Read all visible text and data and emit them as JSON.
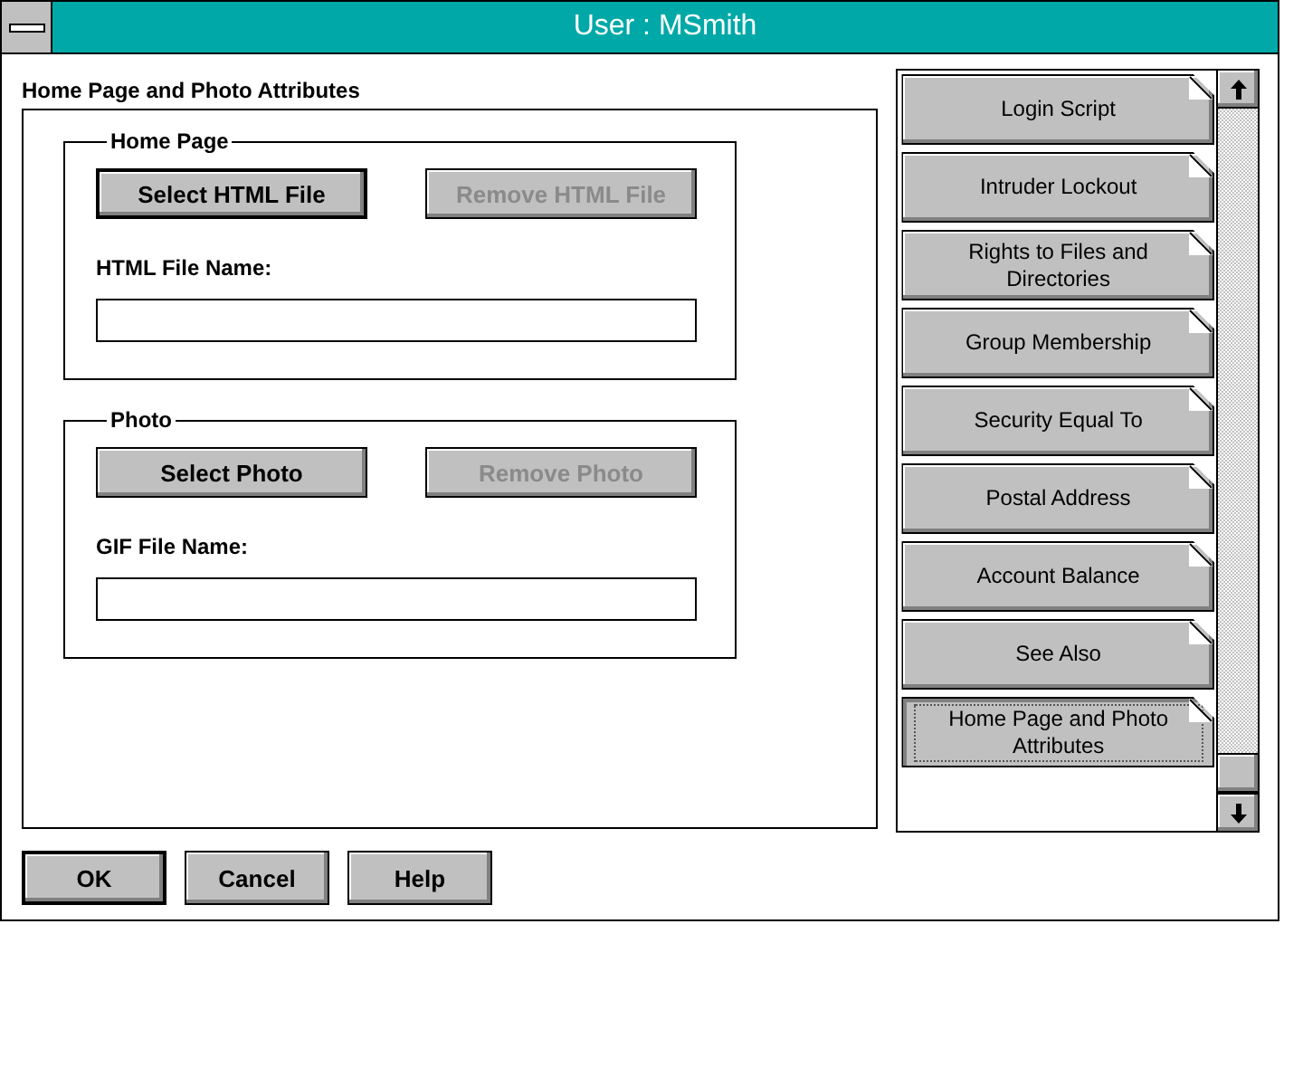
{
  "window": {
    "title": "User : MSmith"
  },
  "section_title": "Home Page and Photo Attributes",
  "groups": [
    {
      "label": "Home Page",
      "buttons": [
        {
          "label": "Select HTML File",
          "disabled": false,
          "default": true
        },
        {
          "label": "Remove HTML File",
          "disabled": true,
          "default": false
        }
      ],
      "field_label": "HTML File Name:"
    },
    {
      "label": "Photo",
      "buttons": [
        {
          "label": "Select Photo",
          "disabled": false,
          "default": false
        },
        {
          "label": "Remove Photo",
          "disabled": true,
          "default": false
        }
      ],
      "field_label": "GIF File Name:"
    }
  ],
  "pages": [
    {
      "label": "Login Script",
      "selected": false
    },
    {
      "label": "Intruder Lockout",
      "selected": false
    },
    {
      "label": "Rights to Files and Directories",
      "selected": false
    },
    {
      "label": "Group Membership",
      "selected": false
    },
    {
      "label": "Security Equal To",
      "selected": false
    },
    {
      "label": "Postal Address",
      "selected": false
    },
    {
      "label": "Account Balance",
      "selected": false
    },
    {
      "label": "See Also",
      "selected": false
    },
    {
      "label": "Home Page and Photo Attributes",
      "selected": true
    }
  ],
  "buttons": [
    {
      "label": "OK",
      "default": true
    },
    {
      "label": "Cancel",
      "default": false
    },
    {
      "label": "Help",
      "default": false
    }
  ]
}
